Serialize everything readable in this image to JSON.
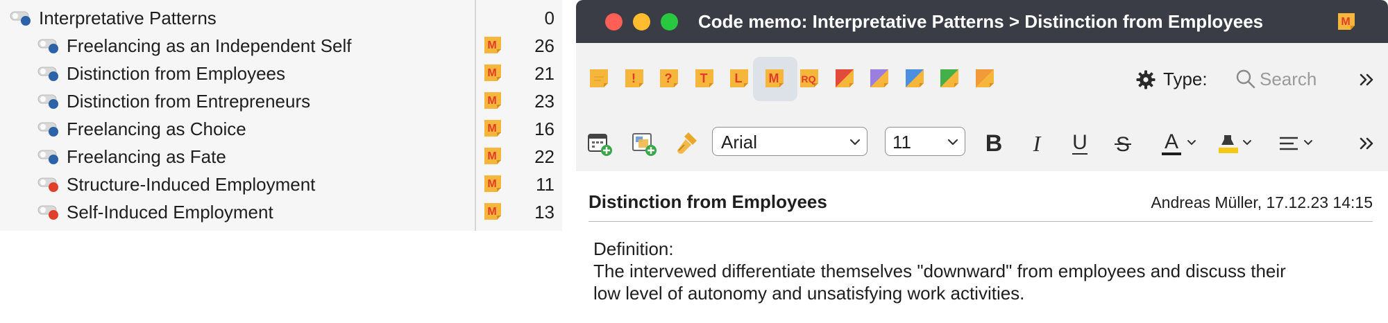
{
  "code_tree": {
    "root": {
      "label": "Interpretative Patterns",
      "count": "0",
      "dot_color": "#2c62a8"
    },
    "children": [
      {
        "label": "Freelancing as an Independent Self",
        "count": "26",
        "dot_color": "#2c62a8"
      },
      {
        "label": "Distinction from Employees",
        "count": "21",
        "dot_color": "#2c62a8"
      },
      {
        "label": "Distinction from Entrepreneurs",
        "count": "23",
        "dot_color": "#2c62a8"
      },
      {
        "label": "Freelancing as Choice",
        "count": "16",
        "dot_color": "#2c62a8"
      },
      {
        "label": "Freelancing as Fate",
        "count": "22",
        "dot_color": "#2c62a8"
      },
      {
        "label": "Structure-Induced Employment",
        "count": "11",
        "dot_color": "#e0402a"
      },
      {
        "label": "Self-Induced Employment",
        "count": "13",
        "dot_color": "#e0402a"
      }
    ],
    "memo_icon_letter": "M"
  },
  "memo_window": {
    "title": "Code memo: Interpretative Patterns > Distinction from Employees",
    "title_icon_letter": "M",
    "memo_types": [
      {
        "name": "memo-type-free",
        "letter": "",
        "color": "#f5b63b",
        "icon": "lines"
      },
      {
        "name": "memo-type-important",
        "letter": "!",
        "color": "#f5b63b",
        "icon": "letter"
      },
      {
        "name": "memo-type-question",
        "letter": "?",
        "color": "#f5b63b",
        "icon": "letter"
      },
      {
        "name": "memo-type-theory",
        "letter": "T",
        "color": "#f5b63b",
        "icon": "letter"
      },
      {
        "name": "memo-type-literature",
        "letter": "L",
        "color": "#f5b63b",
        "icon": "letter"
      },
      {
        "name": "memo-type-method",
        "letter": "M",
        "color": "#f5b63b",
        "icon": "letter"
      },
      {
        "name": "memo-type-research-question",
        "letter": "RQ",
        "color": "#f5b63b",
        "icon": "letter"
      },
      {
        "name": "memo-type-red",
        "letter": "",
        "color": "#e24a3b",
        "icon": "corner"
      },
      {
        "name": "memo-type-purple",
        "letter": "",
        "color": "#9b7fe0",
        "icon": "corner"
      },
      {
        "name": "memo-type-blue",
        "letter": "",
        "color": "#4c8fe0",
        "icon": "corner"
      },
      {
        "name": "memo-type-green",
        "letter": "",
        "color": "#44b04a",
        "icon": "corner"
      },
      {
        "name": "memo-type-orange",
        "letter": "",
        "color": "#f29a38",
        "icon": "corner"
      }
    ],
    "type_label": "Type:",
    "search_placeholder": "Search",
    "font_name": "Arial",
    "font_size": "11",
    "memo_title": "Distinction from Employees",
    "memo_meta": "Andreas Müller, 17.12.23 14:15",
    "memo_body_lines": [
      "Definition:",
      "The intervewed differentiate themselves \"downward\" from employees and discuss their",
      "low level of autonomy and unsatisfying work activities."
    ],
    "selected_type_index": 5
  }
}
